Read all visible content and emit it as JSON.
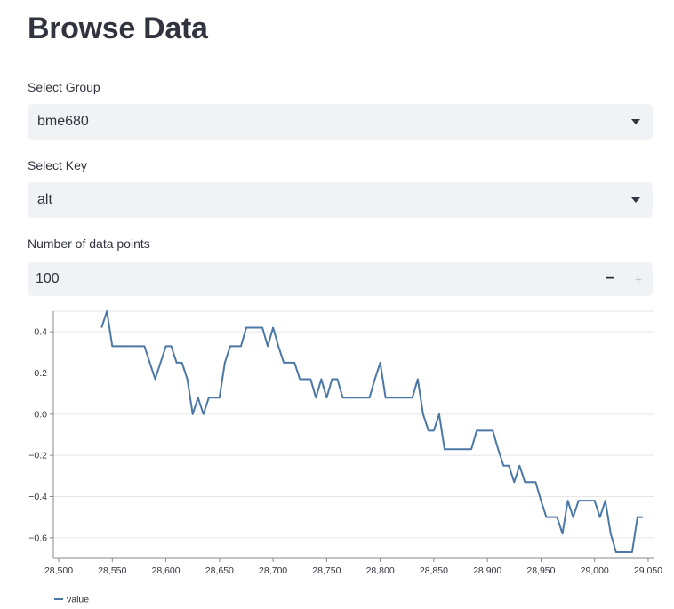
{
  "page": {
    "title": "Browse Data"
  },
  "group_select": {
    "label": "Select Group",
    "value": "bme680"
  },
  "key_select": {
    "label": "Select Key",
    "value": "alt"
  },
  "points_input": {
    "label": "Number of data points",
    "value": "100",
    "minus_label": "−",
    "plus_label": "+"
  },
  "colors": {
    "series_line": "#4c78a8",
    "grid": "#e6e6e6",
    "input_bg": "#f0f2f6"
  },
  "chart_data": {
    "type": "line",
    "series": [
      {
        "name": "value",
        "x": [
          28540,
          28545,
          28550,
          28555,
          28560,
          28565,
          28570,
          28575,
          28580,
          28585,
          28590,
          28595,
          28600,
          28605,
          28610,
          28615,
          28620,
          28625,
          28630,
          28635,
          28640,
          28645,
          28650,
          28655,
          28660,
          28665,
          28670,
          28675,
          28680,
          28685,
          28690,
          28695,
          28700,
          28705,
          28710,
          28715,
          28720,
          28725,
          28730,
          28735,
          28740,
          28745,
          28750,
          28755,
          28760,
          28765,
          28770,
          28775,
          28780,
          28785,
          28790,
          28795,
          28800,
          28805,
          28810,
          28815,
          28820,
          28825,
          28830,
          28835,
          28840,
          28845,
          28850,
          28855,
          28860,
          28865,
          28870,
          28875,
          28880,
          28885,
          28890,
          28895,
          28900,
          28905,
          28910,
          28915,
          28920,
          28925,
          28930,
          28935,
          28940,
          28945,
          28950,
          28955,
          28960,
          28965,
          28970,
          28975,
          28980,
          28985,
          28990,
          28995,
          29000,
          29005,
          29010,
          29015,
          29020,
          29025,
          29030,
          29035,
          29040,
          29045
        ],
        "y": [
          0.42,
          0.5,
          0.33,
          0.33,
          0.33,
          0.33,
          0.33,
          0.33,
          0.33,
          0.25,
          0.17,
          0.25,
          0.33,
          0.33,
          0.25,
          0.25,
          0.17,
          0.0,
          0.08,
          0.0,
          0.08,
          0.08,
          0.08,
          0.25,
          0.33,
          0.33,
          0.33,
          0.42,
          0.42,
          0.42,
          0.42,
          0.33,
          0.42,
          0.33,
          0.25,
          0.25,
          0.25,
          0.17,
          0.17,
          0.17,
          0.08,
          0.17,
          0.08,
          0.17,
          0.17,
          0.08,
          0.08,
          0.08,
          0.08,
          0.08,
          0.08,
          0.17,
          0.25,
          0.08,
          0.08,
          0.08,
          0.08,
          0.08,
          0.08,
          0.17,
          0.0,
          -0.08,
          -0.08,
          0.0,
          -0.17,
          -0.17,
          -0.17,
          -0.17,
          -0.17,
          -0.17,
          -0.08,
          -0.08,
          -0.08,
          -0.08,
          -0.17,
          -0.25,
          -0.25,
          -0.33,
          -0.25,
          -0.33,
          -0.33,
          -0.33,
          -0.42,
          -0.5,
          -0.5,
          -0.5,
          -0.58,
          -0.42,
          -0.5,
          -0.42,
          -0.42,
          -0.42,
          -0.42,
          -0.5,
          -0.42,
          -0.58,
          -0.67,
          -0.67,
          -0.67,
          -0.67,
          -0.5,
          -0.5
        ]
      }
    ],
    "xlim": [
      28495,
      29055
    ],
    "ylim": [
      -0.7,
      0.5
    ],
    "x_ticks": [
      28500,
      28550,
      28600,
      28650,
      28700,
      28750,
      28800,
      28850,
      28900,
      28950,
      29000,
      29050
    ],
    "x_tick_labels": [
      "28,500",
      "28,550",
      "28,600",
      "28,650",
      "28,700",
      "28,750",
      "28,800",
      "28,850",
      "28,900",
      "28,950",
      "29,000",
      "29,050"
    ],
    "y_ticks": [
      0.4,
      0.2,
      0.0,
      -0.2,
      -0.4,
      -0.6
    ],
    "y_tick_labels": [
      "0.4",
      "0.2",
      "0.0",
      "−0.2",
      "−0.4",
      "−0.6"
    ],
    "grid": true,
    "legend": [
      "value"
    ],
    "legend_placement": "bottom-left"
  }
}
